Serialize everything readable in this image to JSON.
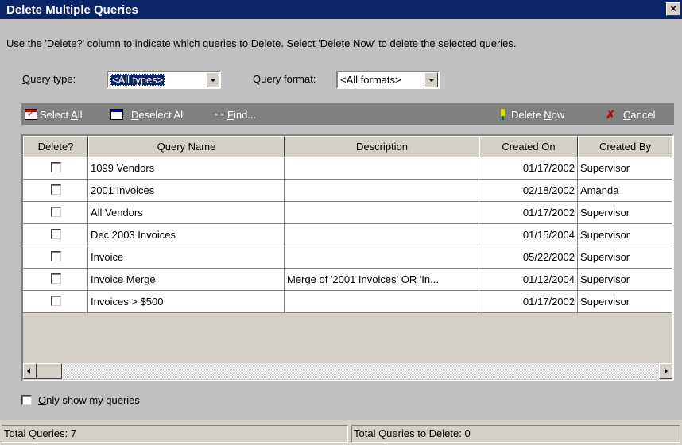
{
  "window": {
    "title": "Delete Multiple Queries",
    "close_glyph": "×"
  },
  "instructions": "Use the 'Delete?' column to indicate which queries to Delete.  Select 'Delete Now' to delete the selected queries.",
  "filters": {
    "query_type_label": "Query type:",
    "query_type_value": "<All types>",
    "query_format_label": "Query format:",
    "query_format_value": "<All formats>"
  },
  "toolbar": {
    "select_all": "Select All",
    "deselect_all": "Deselect All",
    "find": "Find...",
    "delete_now": "Delete Now",
    "cancel": "Cancel"
  },
  "grid": {
    "columns": [
      "Delete?",
      "Query Name",
      "Description",
      "Created On",
      "Created By"
    ],
    "rows": [
      {
        "delete": false,
        "name": "1099 Vendors",
        "description": "",
        "created_on": "01/17/2002",
        "created_by": "Supervisor"
      },
      {
        "delete": false,
        "name": "2001 Invoices",
        "description": "",
        "created_on": "02/18/2002",
        "created_by": "Amanda"
      },
      {
        "delete": false,
        "name": "All Vendors",
        "description": "",
        "created_on": "01/17/2002",
        "created_by": "Supervisor"
      },
      {
        "delete": false,
        "name": "Dec 2003 Invoices",
        "description": "",
        "created_on": "01/15/2004",
        "created_by": "Supervisor"
      },
      {
        "delete": false,
        "name": "Invoice",
        "description": "",
        "created_on": "05/22/2002",
        "created_by": "Supervisor"
      },
      {
        "delete": false,
        "name": "Invoice Merge",
        "description": "Merge of '2001 Invoices' OR 'In...",
        "created_on": "01/12/2004",
        "created_by": "Supervisor"
      },
      {
        "delete": false,
        "name": "Invoices > $500",
        "description": "",
        "created_on": "01/17/2002",
        "created_by": "Supervisor"
      }
    ]
  },
  "only_show_mine": {
    "label": "Only show my queries",
    "checked": false
  },
  "status": {
    "total_queries": "Total Queries: 7",
    "total_to_delete": "Total Queries to Delete: 0"
  },
  "colors": {
    "title_bar": "#0a246a",
    "toolbar": "#808080",
    "dialog_face": "#c0c0c0"
  }
}
